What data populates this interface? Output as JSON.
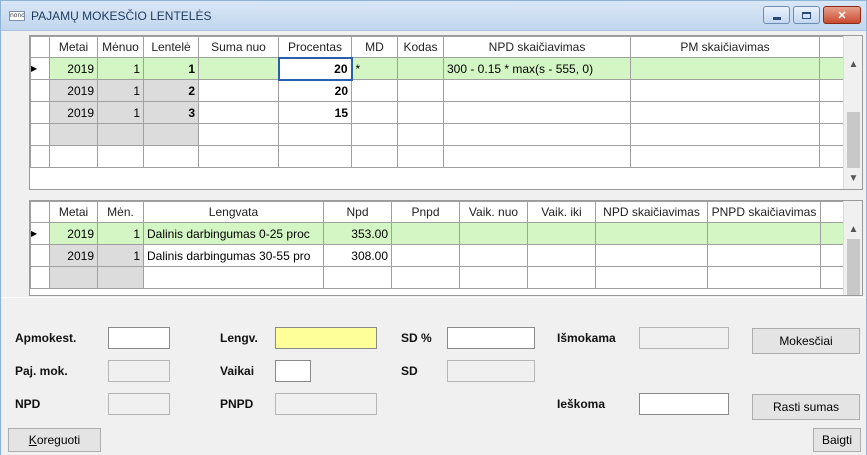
{
  "window": {
    "title": "PAJAMŲ MOKESČIO LENTELĖS",
    "app_icon_text": "nono"
  },
  "top_grid": {
    "headers": [
      "Metai",
      "Mėnuo",
      "Lentelė",
      "Suma nuo",
      "Procentas",
      "MD",
      "Kodas",
      "NPD skaičiavimas",
      "PM skaičiavimas"
    ],
    "rows": [
      {
        "metai": "2019",
        "menuo": "1",
        "lentele": "1",
        "suma_nuo": "",
        "procentas": "20",
        "md": "*",
        "kodas": "",
        "npd": "300 - 0.15 * max(s - 555, 0)",
        "pm": ""
      },
      {
        "metai": "2019",
        "menuo": "1",
        "lentele": "2",
        "suma_nuo": "",
        "procentas": "20",
        "md": "",
        "kodas": "",
        "npd": "",
        "pm": ""
      },
      {
        "metai": "2019",
        "menuo": "1",
        "lentele": "3",
        "suma_nuo": "",
        "procentas": "15",
        "md": "",
        "kodas": "",
        "npd": "",
        "pm": ""
      }
    ]
  },
  "bottom_grid": {
    "headers": [
      "Metai",
      "Mėn.",
      "Lengvata",
      "Npd",
      "Pnpd",
      "Vaik. nuo",
      "Vaik. iki",
      "NPD skaičiavimas",
      "PNPD skaičiavimas"
    ],
    "rows": [
      {
        "metai": "2019",
        "men": "1",
        "lengvata": "Dalinis darbingumas 0-25 proc",
        "npd": "353.00",
        "pnpd": "",
        "vaik_nuo": "",
        "vaik_iki": "",
        "npd_sk": "",
        "pnpd_sk": ""
      },
      {
        "metai": "2019",
        "men": "1",
        "lengvata": "Dalinis darbingumas 30-55 pro",
        "npd": "308.00",
        "pnpd": "",
        "vaik_nuo": "",
        "vaik_iki": "",
        "npd_sk": "",
        "pnpd_sk": ""
      }
    ]
  },
  "form": {
    "apmokest_label": "Apmokest.",
    "paj_mok_label": "Paj. mok.",
    "npd_label": "NPD",
    "lengv_label": "Lengv.",
    "vaikai_label": "Vaikai",
    "pnpd_label": "PNPD",
    "sd_pct_label": "SD %",
    "sd_label": "SD",
    "ismokama_label": "Išmokama",
    "ieskoma_label": "Ieškoma",
    "apmokest_value": "",
    "paj_mok_value": "",
    "npd_value": "",
    "lengv_value": "",
    "vaikai_value": "",
    "pnpd_value": "",
    "sd_pct_value": "",
    "sd_value": "",
    "ismokama_value": "",
    "ieskoma_value": ""
  },
  "buttons": {
    "mokesciai": "Mokesčiai",
    "rasti_sumas": "Rasti sumas",
    "koreguoti_first": "K",
    "koreguoti_rest": "oreguoti",
    "baigti": "Baigti"
  },
  "colors": {
    "active_row": "#d4f6c4",
    "yellow_field": "#ffff99",
    "title_text": "#1e395b"
  }
}
